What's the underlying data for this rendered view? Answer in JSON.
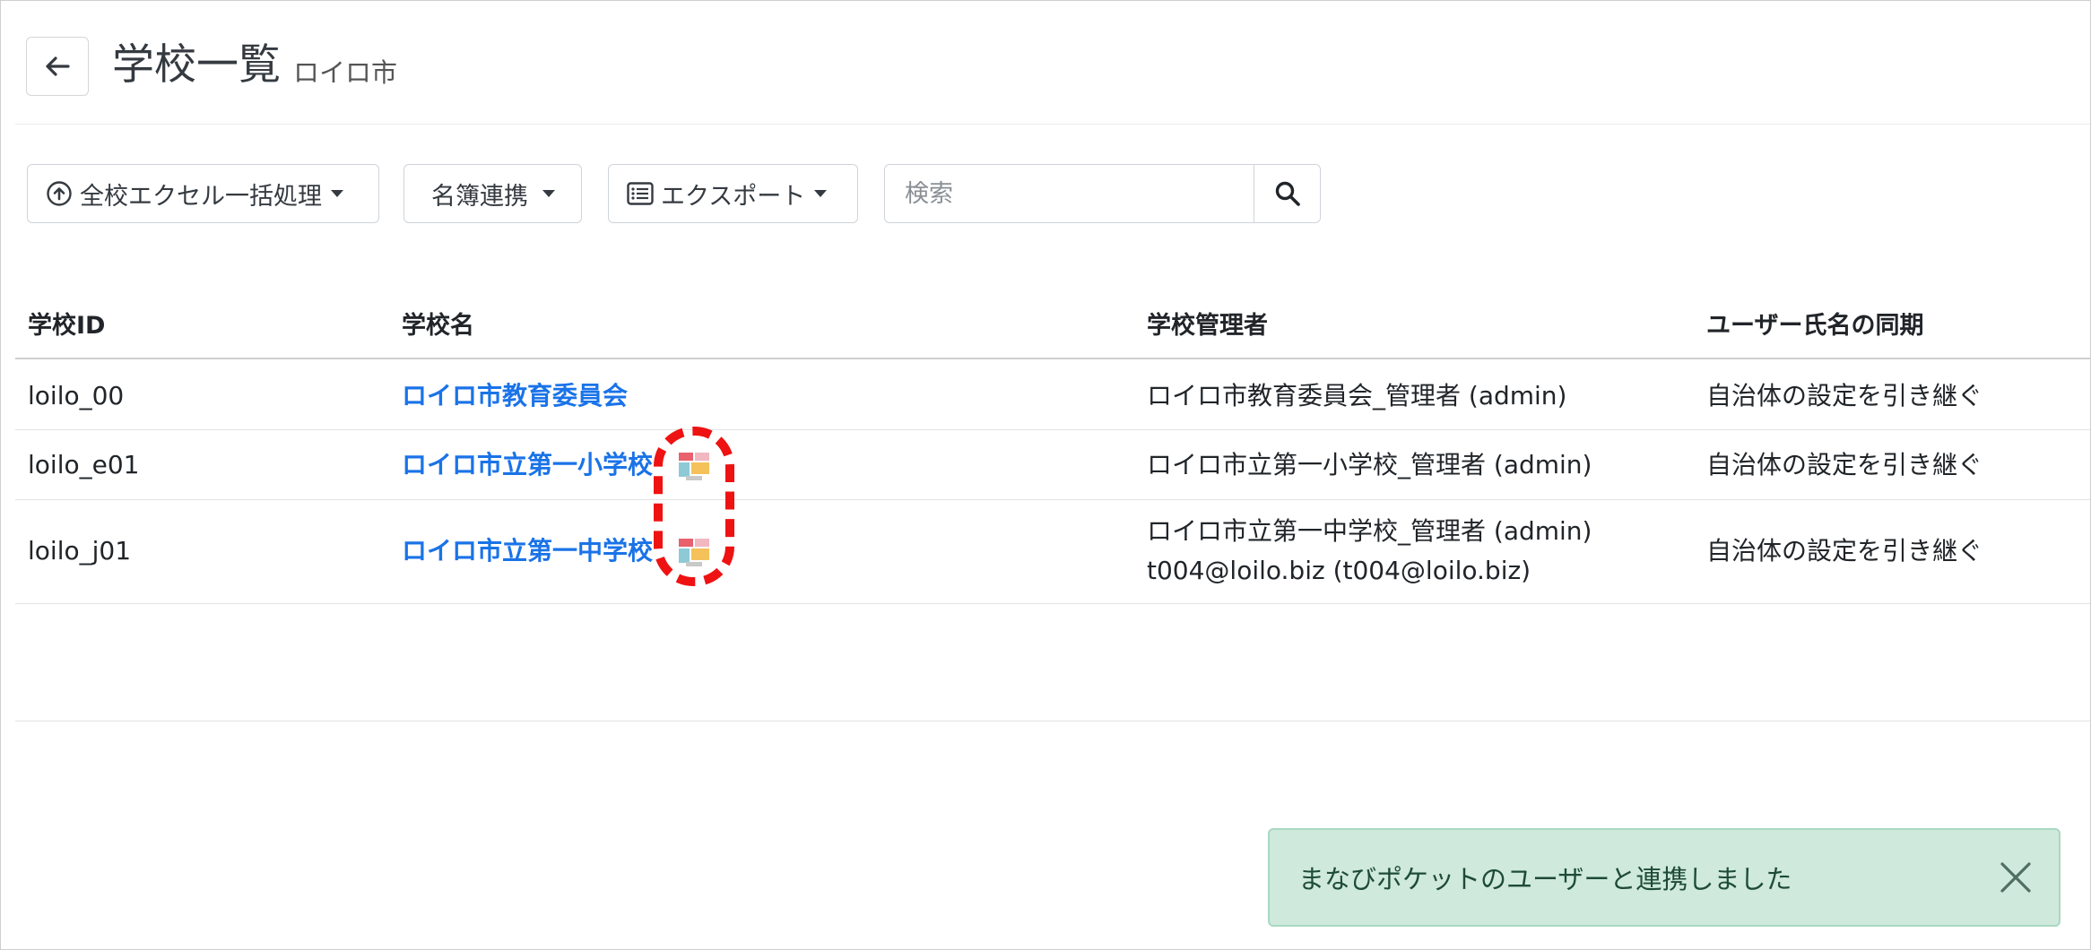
{
  "header": {
    "title": "学校一覧",
    "subtitle": "ロイロ市"
  },
  "toolbar": {
    "excel_label": "全校エクセル一括処理",
    "roster_label": "名簿連携",
    "export_label": "エクスポート",
    "search_placeholder": "検索"
  },
  "table": {
    "columns": [
      "学校ID",
      "学校名",
      "学校管理者",
      "ユーザー氏名の同期"
    ],
    "rows": [
      {
        "id": "loilo_00",
        "name": "ロイロ市教育委員会",
        "admin": [
          "ロイロ市教育委員会_管理者 (admin)"
        ],
        "sync": "自治体の設定を引き継ぐ",
        "manabi_icon": false
      },
      {
        "id": "loilo_e01",
        "name": "ロイロ市立第一小学校",
        "admin": [
          "ロイロ市立第一小学校_管理者 (admin)"
        ],
        "sync": "自治体の設定を引き継ぐ",
        "manabi_icon": true
      },
      {
        "id": "loilo_j01",
        "name": "ロイロ市立第一中学校",
        "admin": [
          "ロイロ市立第一中学校_管理者 (admin)",
          "t004@loilo.biz (t004@loilo.biz)"
        ],
        "sync": "自治体の設定を引き継ぐ",
        "manabi_icon": true
      }
    ]
  },
  "toast": {
    "message": "まなびポケットのユーザーと連携しました"
  },
  "icons": {
    "back": "arrow-left-icon",
    "upload": "upload-circle-icon",
    "list": "list-icon",
    "search": "search-icon",
    "manabi": "manabi-pocket-icon",
    "close": "close-icon"
  },
  "colors": {
    "link": "#1a73e8",
    "toast_bg": "#cfe9dc",
    "highlight": "#ee1212"
  }
}
